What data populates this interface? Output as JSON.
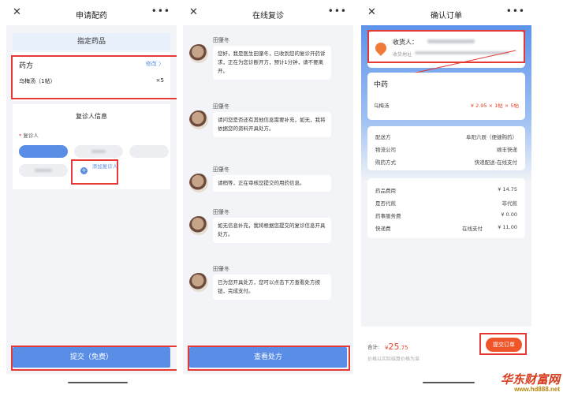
{
  "panel1": {
    "title": "申请配药",
    "section_title": "指定药品",
    "prescription_label": "药方",
    "modify_label": "修改",
    "medicine_name": "乌梅汤（1帖）",
    "medicine_qty": "×5",
    "patient_section_title": "复诊人信息",
    "patient_label": "复诊人",
    "add_patient": "添加复诊人",
    "submit": "提交（免费）"
  },
  "panel2": {
    "title": "在线复诊",
    "messages": [
      {
        "name": "田肇冬",
        "text": "您好，我是医生田肇冬，已收到您的复诊开药诉求，正在为您诊断开方，预计1分钟，请不要离开。"
      },
      {
        "name": "田肇冬",
        "text": "请问您是否还有其他信息需要补充，如无，我将依据您的资料开具处方。"
      },
      {
        "name": "田肇冬",
        "text": "请稍等，正在审核您提交的用药信息。"
      },
      {
        "name": "田肇冬",
        "text": "如无信息补充，我将根据您提交的复诊信息开具处方。"
      },
      {
        "name": "田肇冬",
        "text": "已为您开具处方，您可以点击下方查看处方按钮，完成支付。"
      }
    ],
    "view_button": "查看处方"
  },
  "panel3": {
    "title": "确认订单",
    "receiver_label": "收货人：",
    "address_label": "收货地址",
    "category": "中药",
    "item_name": "乌梅汤",
    "item_price": "¥ 2.95 × 1帖 × 5帖",
    "pharmacy_label": "配送方",
    "pharmacy_value": "阜阳六辰（便捷购药）",
    "logistics_label": "物流公司",
    "logistics_value": "顺丰快递",
    "purchase_label": "购药方式",
    "purchase_value": "快递配送-在线支付",
    "drug_fee_label": "药品费用",
    "drug_fee_value": "¥ 14.75",
    "decoct_label": "是否代煎",
    "decoct_value": "非代煎",
    "service_fee_label": "药事服务费",
    "service_fee_value": "¥ 0.00",
    "express_label": "快递费",
    "express_pay": "在线支付",
    "express_value": "¥ 11.00",
    "total_label": "合计:",
    "total_symbol": "¥",
    "total_int": "25",
    "total_dec": ".75",
    "total_note": "价格以实际结算价格为准",
    "submit": "提交订单"
  },
  "watermark": {
    "brand": "华东财富网",
    "url": "www.hd888.net"
  },
  "colors": {
    "accent_red": "#e53935",
    "primary_blue": "#5a8ee6",
    "price_red": "#e8452c",
    "order_button": "#f0552a"
  },
  "icons": [
    "close-icon",
    "more-icon",
    "chevron-right-icon",
    "location-pin-icon",
    "plus-circle-icon",
    "arrow-annotation-icon"
  ]
}
